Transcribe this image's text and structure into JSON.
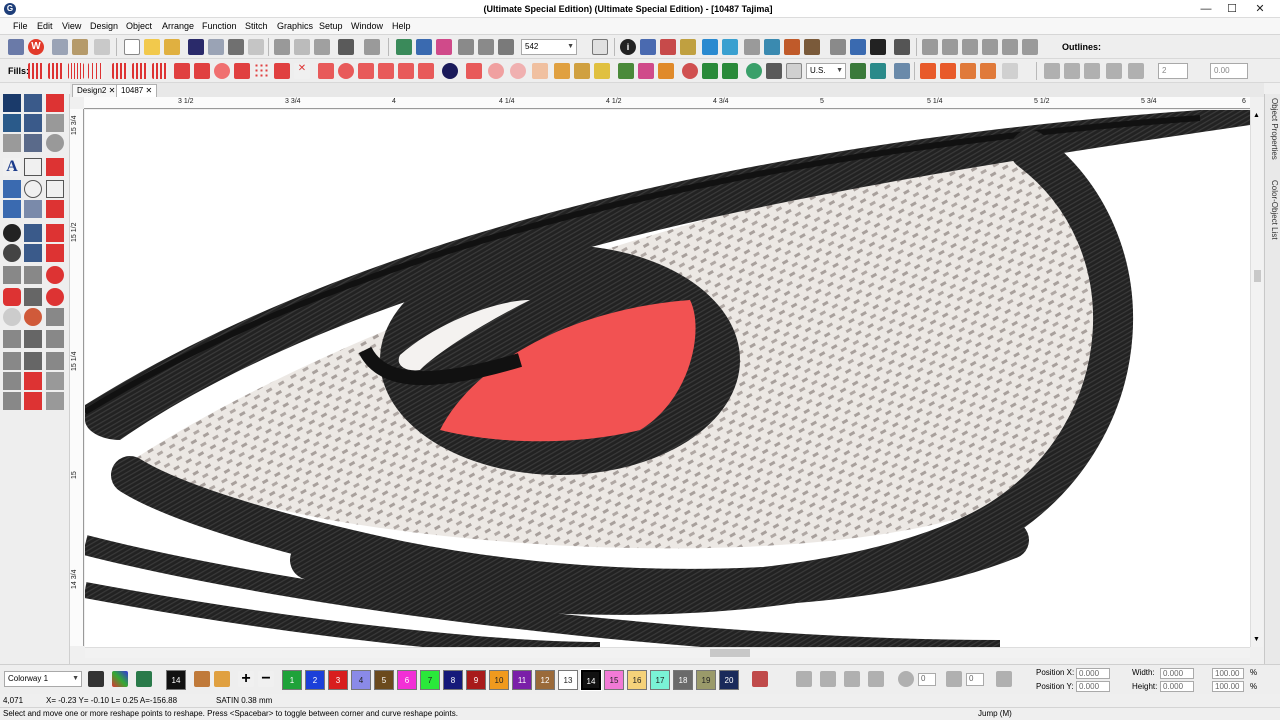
{
  "window": {
    "title": "(Ultimate Special Edition) (Ultimate Special Edition) - [10487     Tajima]",
    "app_icon_glyph": "G",
    "minimize": "—",
    "maximize": "☐",
    "close": "✕"
  },
  "menu": [
    "File",
    "Edit",
    "View",
    "Design",
    "Object",
    "Arrange",
    "Function",
    "Stitch",
    "Graphics",
    "Setup",
    "Window",
    "Help"
  ],
  "toolbar1": {
    "zoom_value": "542",
    "outlines_label": "Outlines:"
  },
  "toolbar2": {
    "fills_label": "Fills:",
    "units_value": "U.S.",
    "count_value": "2",
    "measure_value": "0.00"
  },
  "tabs": [
    {
      "label": "Design2",
      "close": "✕"
    },
    {
      "label": "10487",
      "close": "✕"
    }
  ],
  "ruler_top_labels": [
    "3 1/2",
    "3 3/4",
    "4",
    "4 1/4",
    "4 1/2",
    "4 3/4",
    "5",
    "5 1/4",
    "5 1/2",
    "5 3/4",
    "6"
  ],
  "ruler_left_labels": [
    "15 3/4",
    "15 1/2",
    "15 1/4",
    "15",
    "14 3/4"
  ],
  "side_panel": [
    "Object Properties",
    "Color-Object List"
  ],
  "bottom": {
    "colorway": "Colorway 1",
    "current_color": "14",
    "swatches": [
      {
        "num": "1",
        "color": "#1fa23a"
      },
      {
        "num": "2",
        "color": "#1b3fd9"
      },
      {
        "num": "3",
        "color": "#d81e1e"
      },
      {
        "num": "4",
        "color": "#8a8ae8"
      },
      {
        "num": "5",
        "color": "#6b4a1d"
      },
      {
        "num": "6",
        "color": "#f22fd6"
      },
      {
        "num": "7",
        "color": "#2ae83a"
      },
      {
        "num": "8",
        "color": "#161a7a"
      },
      {
        "num": "9",
        "color": "#a81a1a"
      },
      {
        "num": "10",
        "color": "#f09a1e"
      },
      {
        "num": "11",
        "color": "#7a1fa8"
      },
      {
        "num": "12",
        "color": "#9a6a3a"
      },
      {
        "num": "13",
        "color": "#ffffff"
      },
      {
        "num": "14",
        "color": "#111111"
      },
      {
        "num": "15",
        "color": "#f27ad6"
      },
      {
        "num": "16",
        "color": "#f5d27a"
      },
      {
        "num": "17",
        "color": "#7af2d6"
      },
      {
        "num": "18",
        "color": "#6a6a6a"
      },
      {
        "num": "19",
        "color": "#9a9a6a"
      },
      {
        "num": "20",
        "color": "#1a2a5a"
      }
    ],
    "position_x_label": "Position X:",
    "position_y_label": "Position Y:",
    "position_x": "0.000",
    "position_y": "0.000",
    "width_label": "Width:",
    "height_label": "Height:",
    "width": "0.000",
    "height": "0.000",
    "width_pct": "100.00",
    "height_pct": "100.00",
    "pct_unit": "%",
    "rotate_value": "0",
    "offset_value": "0"
  },
  "status": {
    "stitch_count": "4,071",
    "coords": "X=  -0.23 Y=  -0.10 L=   0.25 A=-156.88",
    "stitch_type": "SATIN  0.38 mm",
    "hint": "Select and move one or more reshape points to reshape. Press <Spacebar> to toggle between corner and curve reshape points.",
    "mode": "Jump (M)"
  },
  "colors": {
    "thread_black": "#1c1c1c",
    "thread_white": "#ece8e4",
    "thread_red": "#f25252",
    "canvas": "#ffffff"
  }
}
